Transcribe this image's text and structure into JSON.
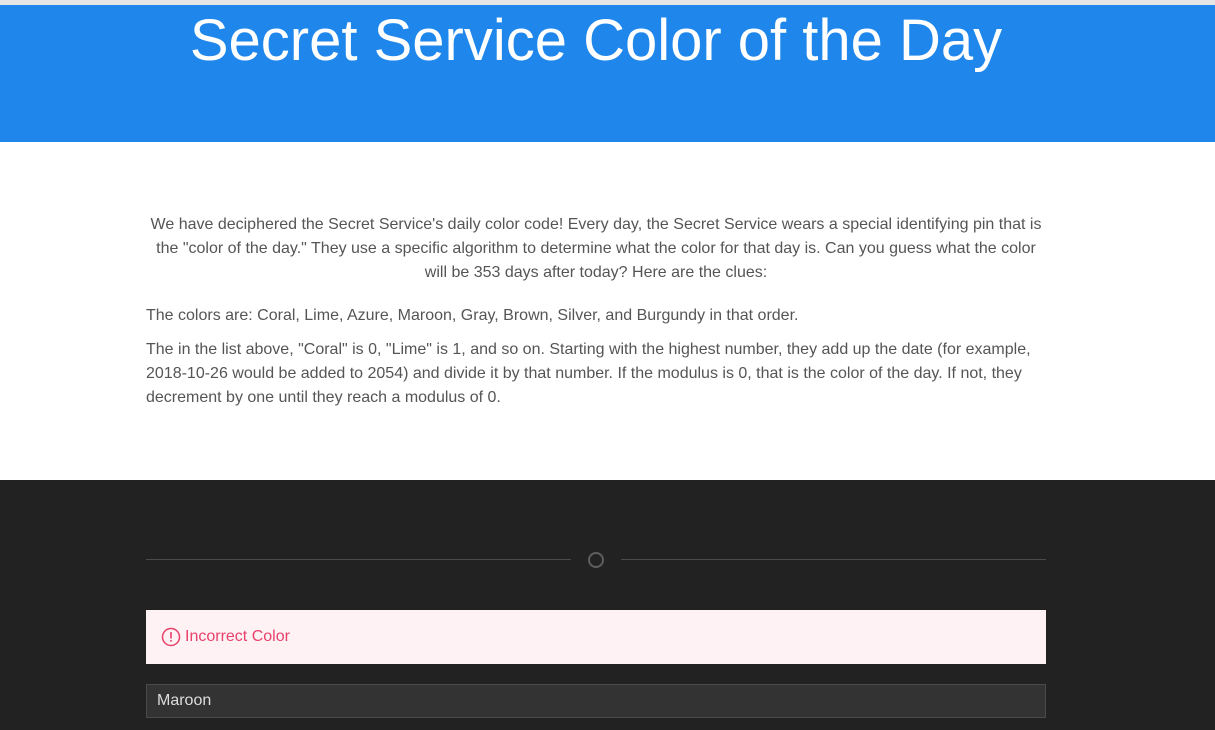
{
  "header": {
    "title": "Secret Service Color of the Day"
  },
  "main": {
    "intro": "We have deciphered the Secret Service's daily color code! Every day, the Secret Service wears a special identifying pin that is the \"color of the day.\" They use a specific algorithm to determine what the color for that day is. Can you guess what the color will be 353 days after today? Here are the clues:",
    "clue_colors": "The colors are: Coral, Lime, Azure, Maroon, Gray, Brown, Silver, and Burgundy in that order.",
    "clue_algorithm": "The in the list above, \"Coral\" is 0, \"Lime\" is 1, and so on. Starting with the highest number, they add up the date (for example, 2018-10-26 would be added to 2054) and divide it by that number. If the modulus is 0, that is the color of the day. If not, they decrement by one until they reach a modulus of 0."
  },
  "footer": {
    "divider_icon": "circle-icon",
    "alert": {
      "icon": "exclamation-circle-icon",
      "message": "Incorrect Color",
      "color": "#e8416b",
      "background": "#fff2f4"
    },
    "answer_input": {
      "value": "Maroon"
    }
  },
  "colors": {
    "header_bg": "#1f87ec",
    "footer_bg": "#222222",
    "text": "#555555"
  }
}
